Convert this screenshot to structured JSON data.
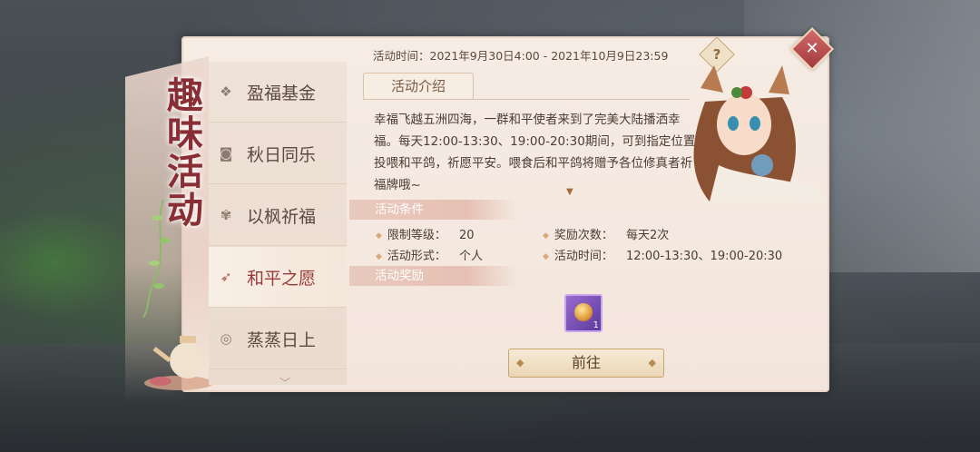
{
  "banner": {
    "title": "趣味活动"
  },
  "sidebar": {
    "items": [
      {
        "label": "盈福基金",
        "icon": "coin-icon",
        "active": false
      },
      {
        "label": "秋日同乐",
        "icon": "camera-icon",
        "active": false
      },
      {
        "label": "以枫祈福",
        "icon": "maple-leaf-icon",
        "active": false
      },
      {
        "label": "和平之愿",
        "icon": "dove-icon",
        "active": true
      },
      {
        "label": "蒸蒸日上",
        "icon": "ring-icon",
        "active": false
      }
    ]
  },
  "header": {
    "time_label": "活动时间：2021年9月30日4:00 - 2021年10月9日23:59",
    "help": "?",
    "close": "✕"
  },
  "intro": {
    "tab": "活动介绍",
    "text": "幸福飞越五洲四海，一群和平使者来到了完美大陆播洒幸福。每天12:00-13:30、19:00-20:30期间，可到指定位置投喂和平鸽，祈愿平安。喂食后和平鸽将赠予各位修真者祈福牌哦~"
  },
  "conditions": {
    "title": "活动条件",
    "level_key": "限制等级：",
    "level_val": "20",
    "count_key": "奖励次数：",
    "count_val": "每天2次",
    "form_key": "活动形式：",
    "form_val": "个人",
    "time_key": "活动时间：",
    "time_val": "12:00-13:30、19:00-20:30"
  },
  "rewards": {
    "title": "活动奖励",
    "item_count": "1"
  },
  "go_button": "前往",
  "colors": {
    "accent_red": "#9b3a3a",
    "panel_bg": "#f6ece4",
    "section_header": "#e6c1b3"
  }
}
